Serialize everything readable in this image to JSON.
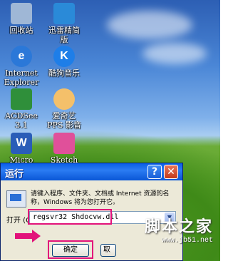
{
  "desktop": {
    "icons": [
      {
        "name": "recycle-bin",
        "label": "回收站",
        "icon": "recycle-bin-icon",
        "color": "#9fb7d6"
      },
      {
        "name": "xunlei",
        "label": "迅雷精简\n版",
        "icon": "xunlei-bird-icon",
        "color": "#2a8ad8"
      },
      {
        "name": "ie",
        "label": "Internet\nExplorer",
        "icon": "internet-explorer-icon",
        "color": "#2b78d8"
      },
      {
        "name": "kugou",
        "label": "酷狗音乐",
        "icon": "kugou-k-icon",
        "color": "#1e7ee8"
      },
      {
        "name": "acdsee",
        "label": "ACDSee\n3.1",
        "icon": "acdsee-eye-icon",
        "color": "#2f8f3a"
      },
      {
        "name": "pps",
        "label": "爱奇艺\nPPS 影音",
        "icon": "pps-face-icon",
        "color": "#f4c06a"
      },
      {
        "name": "word",
        "label": "Micro",
        "icon": "word-icon",
        "color": "#2a5db8"
      },
      {
        "name": "sketch",
        "label": "Sketch",
        "icon": "sketch-icon",
        "color": "#e0509a"
      }
    ],
    "glyphs": {
      "word": "W",
      "kugou": "K",
      "ie": "e"
    }
  },
  "run_dialog": {
    "title": "运行",
    "help_label": "?",
    "close_label": "✕",
    "description": "请键入程序、文件夹、文档或 Internet 资源的名称，Windows 将为您打开它。",
    "open_label": "打开 (O):",
    "command_value": "regsvr32 Shdocvw.dll",
    "combo_arrow": "▼",
    "ok_label": "确定",
    "cancel_partial": "取"
  },
  "watermark": {
    "title": "脚本之家",
    "url": "www.jb51.net"
  },
  "colors": {
    "highlight": "#e2127a",
    "titlebar": "#0a5de8"
  }
}
